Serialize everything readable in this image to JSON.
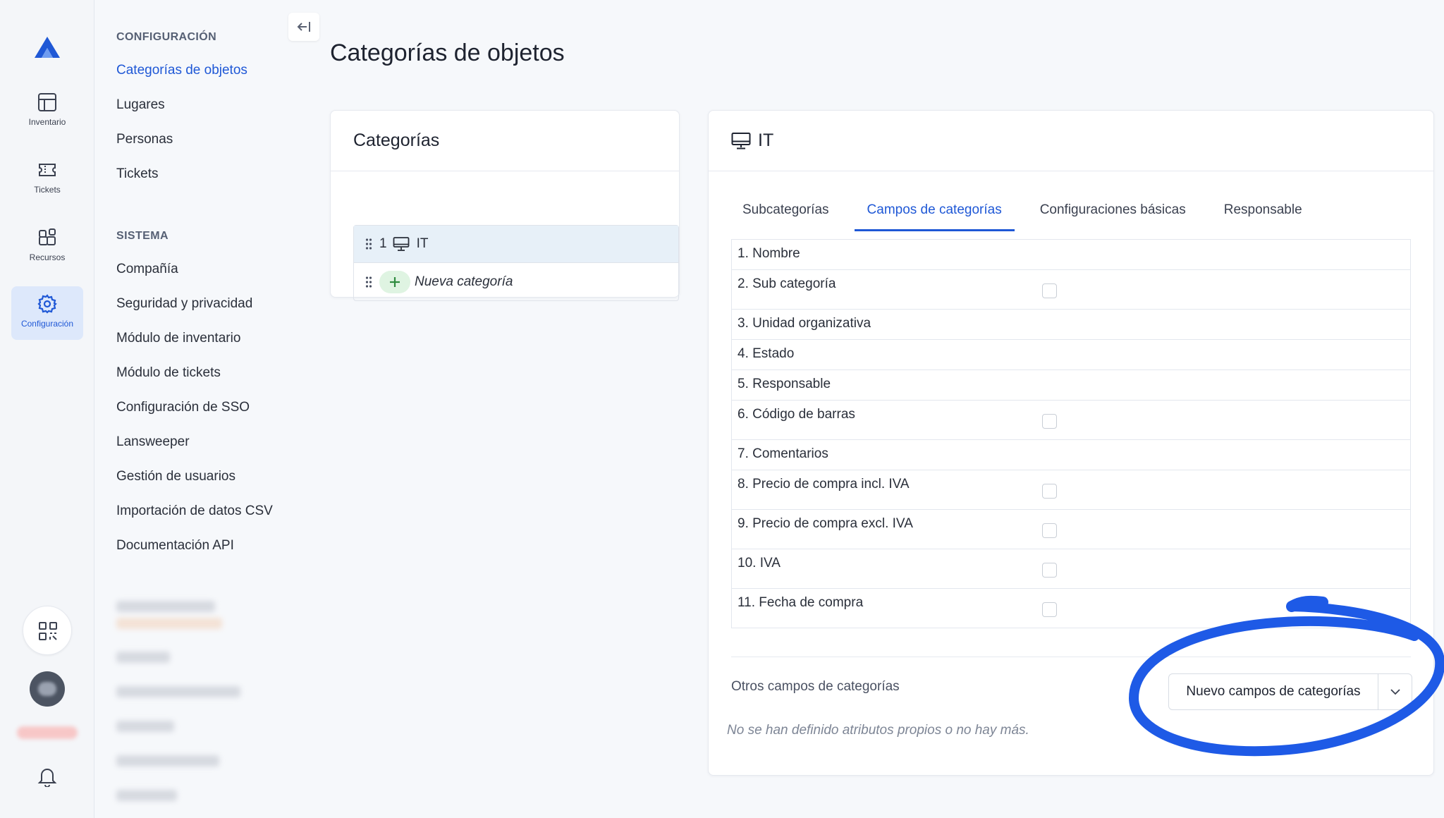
{
  "rail": {
    "items": [
      {
        "label": "Inventario",
        "icon": "inventory-grid-icon"
      },
      {
        "label": "Tickets",
        "icon": "ticket-icon"
      },
      {
        "label": "Recursos",
        "icon": "resources-icon"
      },
      {
        "label": "Configuración",
        "icon": "gear-icon",
        "active": true
      }
    ],
    "accent_color": "#1f58d6"
  },
  "menu": {
    "section1_heading": "CONFIGURACIÓN",
    "section1_items": [
      "Categorías de objetos",
      "Lugares",
      "Personas",
      "Tickets"
    ],
    "section2_heading": "SISTEMA",
    "section2_items": [
      "Compañía",
      "Seguridad y privacidad",
      "Módulo de inventario",
      "Módulo de tickets",
      "Configuración de SSO",
      "Lansweeper",
      "Gestión de usuarios",
      "Importación de datos CSV",
      "Documentación API"
    ],
    "active_item": "Categorías de objetos"
  },
  "page": {
    "title": "Categorías de objetos"
  },
  "categories_card": {
    "title": "Categorías",
    "rows": [
      {
        "number": "1",
        "label": "IT",
        "icon": "monitor-icon"
      }
    ],
    "new_category_label": "Nueva categoría"
  },
  "detail_card": {
    "title": "IT",
    "icon": "monitor-icon",
    "tabs": [
      "Subcategorías",
      "Campos de categorías",
      "Configuraciones básicas",
      "Responsable"
    ],
    "active_tab": "Campos de categorías",
    "fields": [
      {
        "label": "1. Nombre",
        "checkbox": false
      },
      {
        "label": "2. Sub categoría",
        "checkbox": true
      },
      {
        "label": "3. Unidad organizativa",
        "checkbox": false
      },
      {
        "label": "4. Estado",
        "checkbox": false
      },
      {
        "label": "5. Responsable",
        "checkbox": false
      },
      {
        "label": "6. Código de barras",
        "checkbox": true
      },
      {
        "label": "7. Comentarios",
        "checkbox": false
      },
      {
        "label": "8. Precio de compra incl. IVA",
        "checkbox": true
      },
      {
        "label": "9. Precio de compra excl. IVA",
        "checkbox": true
      },
      {
        "label": "10. IVA",
        "checkbox": true
      },
      {
        "label": "11. Fecha de compra",
        "checkbox": true
      }
    ],
    "other_fields_label": "Otros campos de categorías",
    "empty_note": "No se han definido atributos propios o no hay más.",
    "new_field_button": "Nuevo campos de categorías",
    "annotation_color": "#1e5ae6"
  }
}
